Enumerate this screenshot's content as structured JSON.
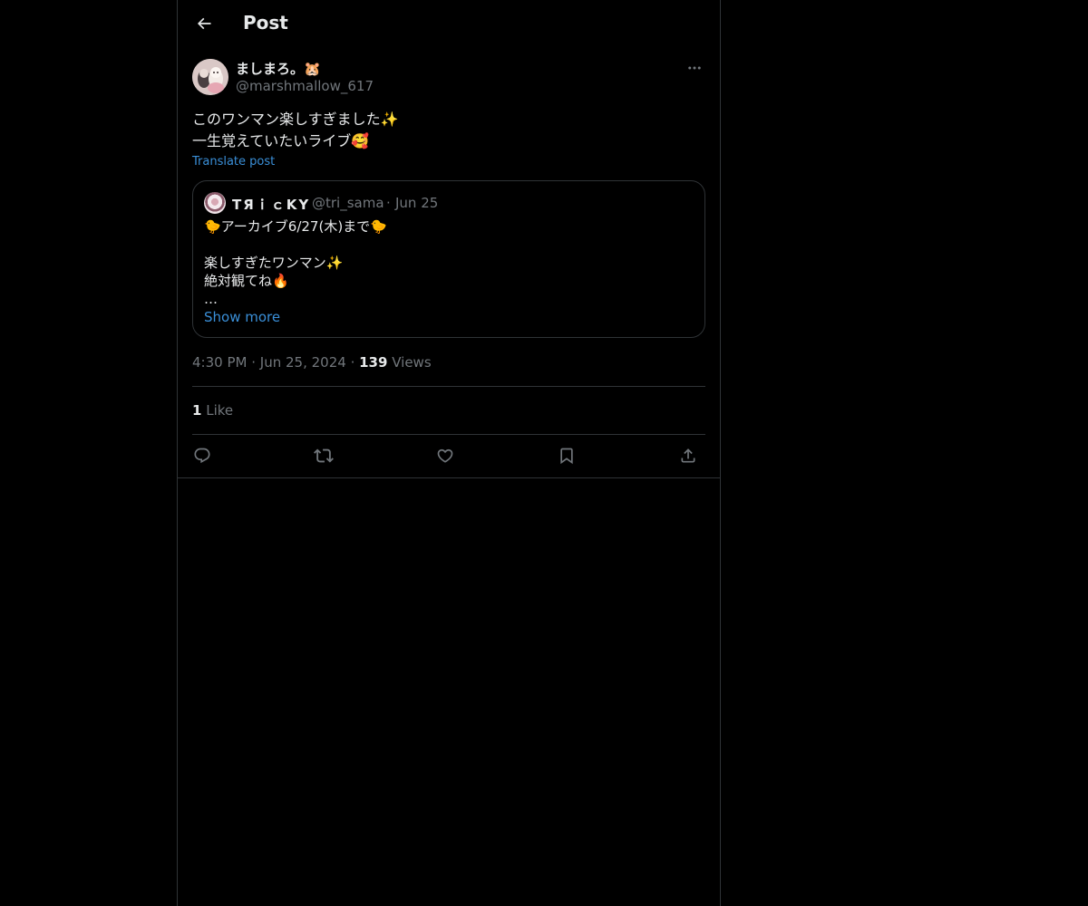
{
  "header": {
    "title": "Post"
  },
  "post": {
    "author_name": "ましまろ。🐹",
    "author_handle": "@marshmallow_617",
    "text_line1": "このワンマン楽しすぎました✨",
    "text_line2": "一生覚えていたいライブ🥰",
    "translate_label": "Translate post",
    "time": "4:30 PM",
    "date": "Jun 25, 2024",
    "views_count": "139",
    "views_label": "Views",
    "likes_count": "1",
    "likes_label": "Like"
  },
  "quote": {
    "author_name": "TЯｉｃKY",
    "author_handle": "@tri_sama",
    "date": "Jun 25",
    "text": "🐤アーカイブ6/27(木)まで🐤\n\n楽しすぎたワンマン✨\n絶対観てね🔥\n…",
    "show_more": "Show more"
  },
  "actions": [
    {
      "name": "reply",
      "icon": "reply-icon"
    },
    {
      "name": "repost",
      "icon": "repost-icon"
    },
    {
      "name": "like",
      "icon": "heart-icon"
    },
    {
      "name": "bookmark",
      "icon": "bookmark-icon"
    },
    {
      "name": "share",
      "icon": "share-icon"
    }
  ],
  "colors": {
    "background": "#000000",
    "text": "#e7e9ea",
    "muted": "#71767b",
    "link": "#3a8fd8",
    "border": "#2f3336"
  }
}
